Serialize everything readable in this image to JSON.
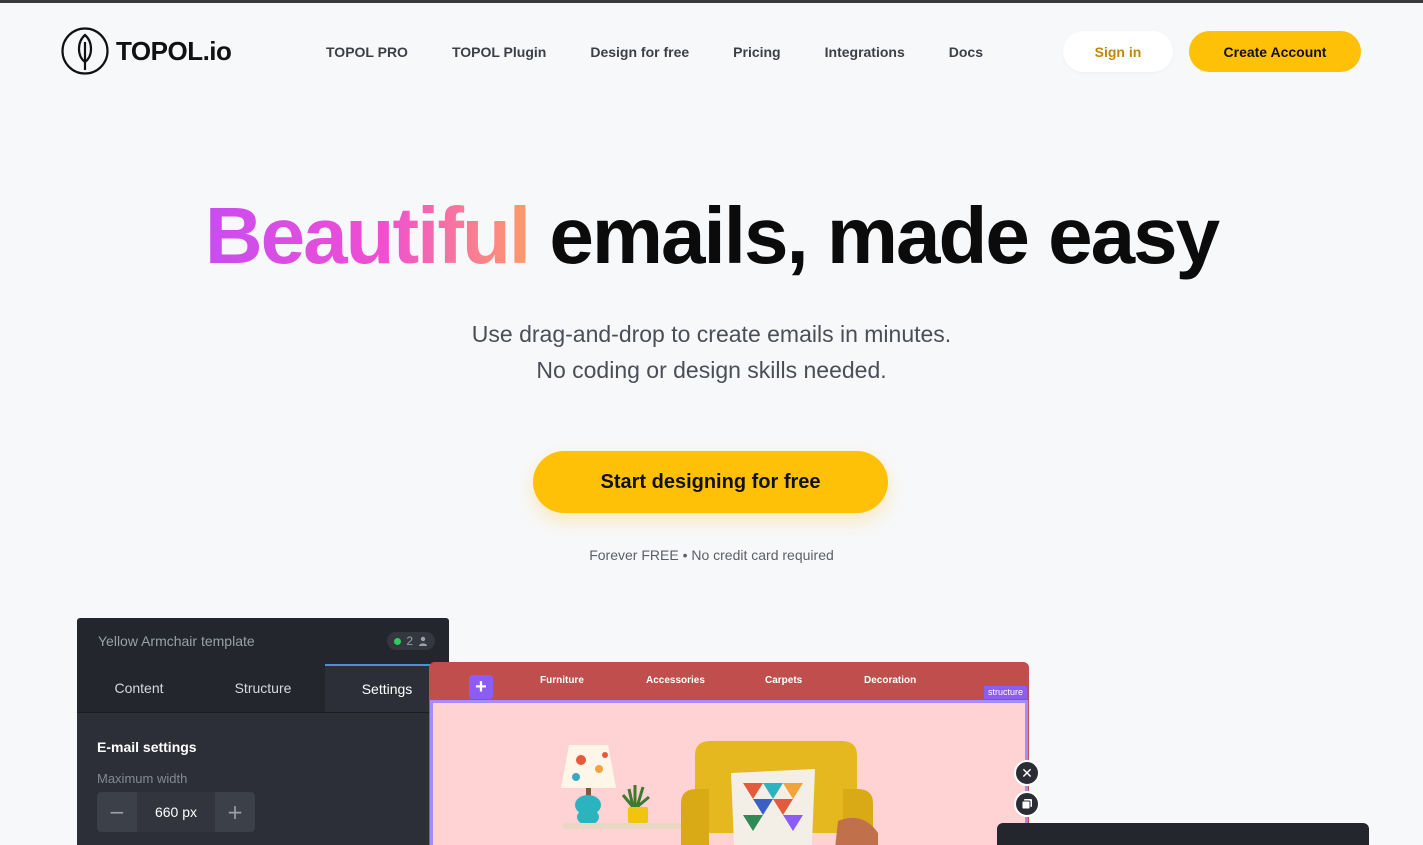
{
  "brand": {
    "logo_text": "TOPOL.io"
  },
  "nav": {
    "items": [
      {
        "label": "TOPOL PRO"
      },
      {
        "label": "TOPOL Plugin"
      },
      {
        "label": "Design for free"
      },
      {
        "label": "Pricing"
      },
      {
        "label": "Integrations"
      },
      {
        "label": "Docs"
      }
    ],
    "sign_in": "Sign in",
    "create_account": "Create Account"
  },
  "hero": {
    "title_highlight": "Beautiful",
    "title_rest": "emails, made easy",
    "subtitle_line1": "Use drag-and-drop to create emails in minutes.",
    "subtitle_line2": "No coding or design skills needed.",
    "cta": "Start designing for free",
    "note": "Forever FREE • No credit card required"
  },
  "editor": {
    "template_name": "Yellow Armchair template",
    "online_users": "2",
    "tabs": [
      {
        "label": "Content"
      },
      {
        "label": "Structure"
      },
      {
        "label": "Settings",
        "active": true
      }
    ],
    "section_title": "E-mail settings",
    "max_width_label": "Maximum width",
    "max_width_value": "660 px",
    "minus": "−",
    "plus": "+"
  },
  "email_preview": {
    "menu": [
      {
        "label": "Furniture"
      },
      {
        "label": "Accessories"
      },
      {
        "label": "Carpets"
      },
      {
        "label": "Decoration"
      }
    ],
    "add_icon": "plus-icon",
    "structure_label": "structure"
  },
  "colors": {
    "accent": "#ffc107",
    "gradient_start": "#c94cf2",
    "gradient_end": "#ff9a6a",
    "email_header": "#bf4e4c",
    "email_canvas": "#ffd3d3",
    "selection": "#8b5cf6"
  }
}
